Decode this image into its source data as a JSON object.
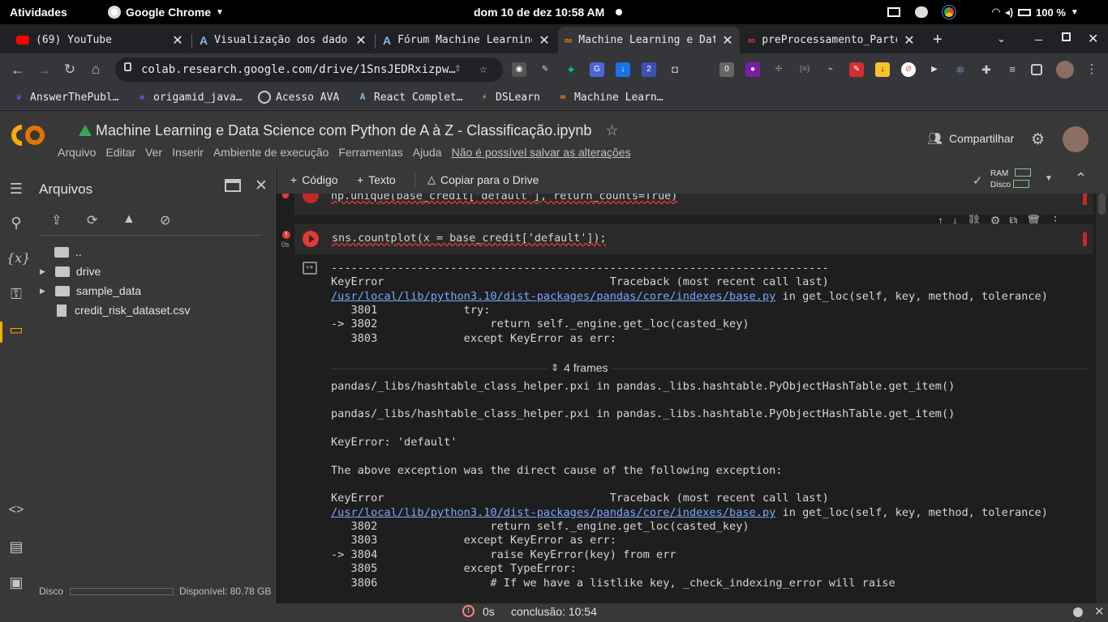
{
  "topbar": {
    "activities": "Atividades",
    "app": "Google Chrome",
    "clock": "dom 10 de dez 10:58 AM",
    "battery": "100 %"
  },
  "tabs": [
    {
      "title": "(69) YouTube",
      "icon": "youtube-icon",
      "active": false
    },
    {
      "title": "Visualização dos dados",
      "icon": "alura-icon",
      "active": false
    },
    {
      "title": "Fórum Machine Learning",
      "icon": "alura-icon",
      "active": false
    },
    {
      "title": "Machine Learning e Data",
      "icon": "colab-icon",
      "active": true
    },
    {
      "title": "preProcessamento_Parte",
      "icon": "colab-icon",
      "active": false
    }
  ],
  "toolbar": {
    "url": "colab.research.google.com/drive/1SnsJEDRxizpw…"
  },
  "bookmarks": [
    {
      "label": "AnswerThePubl…",
      "icon": "answerthepublic-icon"
    },
    {
      "label": "origamid_java…",
      "icon": "origamid-icon"
    },
    {
      "label": "Acesso AVA",
      "icon": "globe-icon"
    },
    {
      "label": "React Complet…",
      "icon": "alura-icon"
    },
    {
      "label": "DSLearn",
      "icon": "lightning-icon"
    },
    {
      "label": "Machine Learn…",
      "icon": "colab-icon"
    }
  ],
  "colab": {
    "title": "Machine Learning e Data Science com Python de A à Z - Classificação.ipynb",
    "menus": [
      "Arquivo",
      "Editar",
      "Ver",
      "Inserir",
      "Ambiente de execução",
      "Ferramentas",
      "Ajuda"
    ],
    "save_warning": "Não é possível salvar as alterações",
    "share": "Compartilhar"
  },
  "files": {
    "title": "Arquivos",
    "items": [
      {
        "name": "..",
        "type": "up"
      },
      {
        "name": "drive",
        "type": "folder"
      },
      {
        "name": "sample_data",
        "type": "folder"
      },
      {
        "name": "credit_risk_dataset.csv",
        "type": "file"
      }
    ],
    "disk_label": "Disco",
    "disk_available": "Disponível: 80.78 GB"
  },
  "nbtoolbar": {
    "code": "Código",
    "text": "Texto",
    "copy": "Copiar para o Drive",
    "ram": "RAM",
    "disk": "Disco"
  },
  "cells": {
    "prev_code": "np.unique(base_credit['default'], return_counts=True)",
    "code": "sns.countplot(x = base_credit['default']);",
    "exec_time": "0s"
  },
  "output": {
    "dashes": "---------------------------------------------------------------------------",
    "err1": "KeyError                                  Traceback (most recent call last)",
    "path1": "/usr/local/lib/python3.10/dist-packages/pandas/core/indexes/base.py",
    "in1": " in get_loc(self, key, method, tolerance)",
    "l1": "   3801             try:",
    "l2": "-> 3802                 return self._engine.get_loc(casted_key)",
    "l3": "   3803             except KeyError as err:",
    "frames": "4 frames",
    "hash1": "pandas/_libs/hashtable_class_helper.pxi in pandas._libs.hashtable.PyObjectHashTable.get_item()",
    "hash2": "pandas/_libs/hashtable_class_helper.pxi in pandas._libs.hashtable.PyObjectHashTable.get_item()",
    "keyerr": "KeyError: 'default'",
    "cause": "The above exception was the direct cause of the following exception:",
    "err2": "KeyError                                  Traceback (most recent call last)",
    "path2": "/usr/local/lib/python3.10/dist-packages/pandas/core/indexes/base.py",
    "in2": " in get_loc(self, key, method, tolerance)",
    "m1": "   3802                 return self._engine.get_loc(casted_key)",
    "m2": "   3803             except KeyError as err:",
    "m3": "-> 3804                 raise KeyError(key) from err",
    "m4": "   3805             except TypeError:",
    "m5": "   3806                 # If we have a listlike key, _check_indexing_error will raise"
  },
  "status": {
    "time": "0s",
    "completed": "conclusão: 10:54"
  }
}
